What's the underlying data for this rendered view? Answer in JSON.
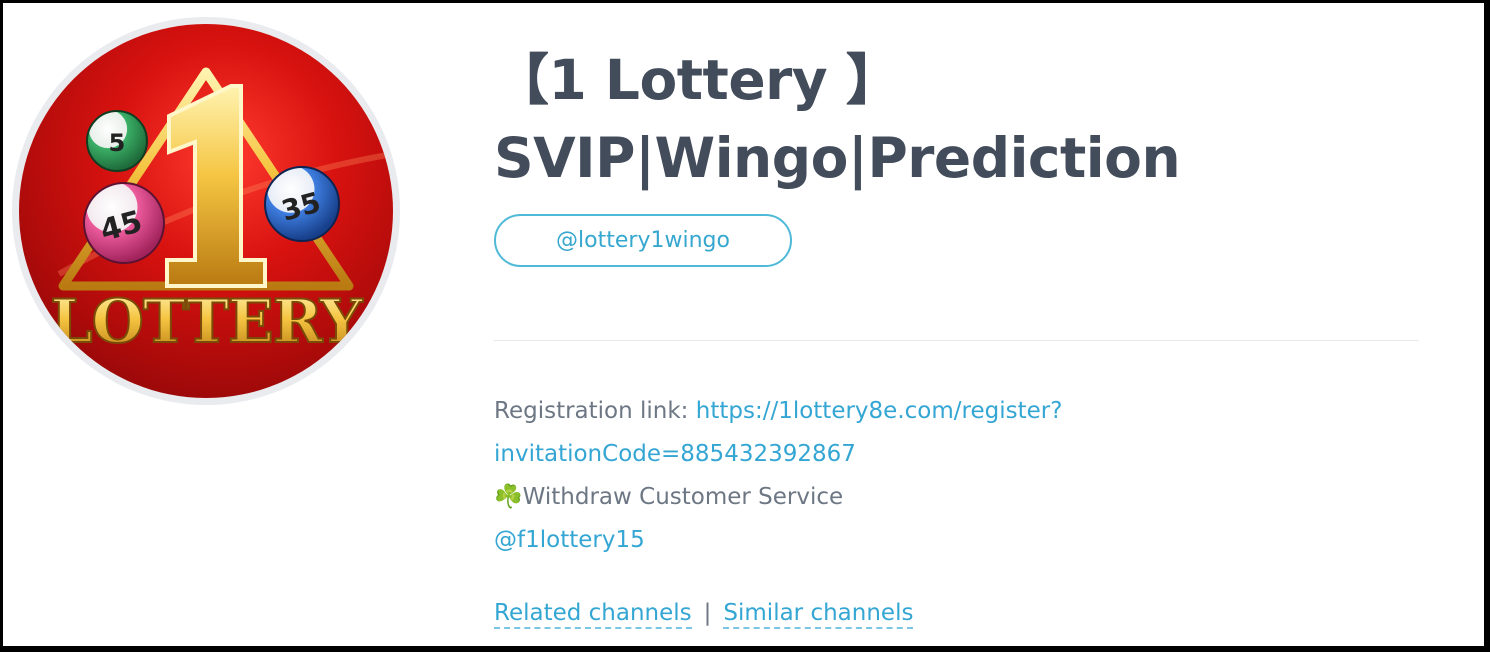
{
  "channel": {
    "title_line1": "【1 Lottery 】",
    "title_line2": "SVIP|Wingo|Prediction",
    "username": "@lottery1wingo",
    "avatar": {
      "icon": "lottery-logo",
      "brand_text": "LOTTERY",
      "big_number": "1",
      "balls": [
        "5",
        "45",
        "35"
      ],
      "colors": {
        "background": "#d8120f",
        "gold": "#f5c542",
        "ball_green": "#2e9b55",
        "ball_pink": "#e0488c",
        "ball_blue": "#2a66c9"
      }
    }
  },
  "description": {
    "registration_label": "Registration link: ",
    "registration_url_part1": "https://1lottery8e.com/register?",
    "registration_url_part2": "invitationCode=885432392867",
    "clover_icon": "☘️",
    "service_text": "Withdraw Customer Service",
    "service_handle": "@f1lottery15"
  },
  "footer": {
    "related_label": "Related channels",
    "separator": "|",
    "similar_label": "Similar channels"
  },
  "colors": {
    "title": "#434c5a",
    "accent": "#34a6d3",
    "muted_text": "#6d7784"
  }
}
